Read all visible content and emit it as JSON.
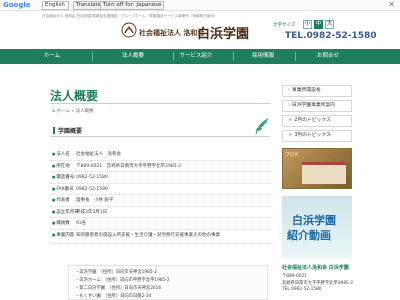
{
  "translate_bar": {
    "google_label": "Google",
    "translate_from_label": "Translate from:",
    "from_value": "English",
    "translate_button": "Translate",
    "turn_off_button": "Turn off for: Japanese",
    "close": "✕"
  },
  "header": {
    "tagline": "社会福祉法人 洛和会 白浜学園 障害者支援施設・グループホーム・障害福祉サービス事業所（宮崎県日南市）",
    "org_small": "社会福祉法人 洛和会",
    "org_big": "白浜学園",
    "fontsize_label": "文字サイズ",
    "fontsize_buttons": [
      "小",
      "中",
      "大"
    ],
    "tel": "TEL.0982-52-1580"
  },
  "nav": [
    "ホーム",
    "法人概要",
    "サービス紹介",
    "採用情報",
    "お問合せ"
  ],
  "main": {
    "page_title": "法人概要",
    "breadcrumb_home": "ホーム",
    "breadcrumb_current": "法人概要",
    "section_title": "学園概要",
    "rows": [
      {
        "label": "法人名",
        "value": "社会福祉法人　洛和会"
      },
      {
        "label": "所在地",
        "value": "〒889-0021　宮崎県日南市大字平野字北平2985-2"
      },
      {
        "label": "電話番号",
        "value": "0982-52-1580"
      },
      {
        "label": "FAX番号",
        "value": "0982-52-1599"
      },
      {
        "label": "代表者",
        "value": "理事長　小林 鋭子"
      },
      {
        "label": "設立年月日",
        "value": "平成3年3月1日"
      },
      {
        "label": "職員数",
        "value": "93名"
      },
      {
        "label": "事業内容",
        "value": "知的障害者の施設入所支援・生活介護・就労移行支援事業その他の事業"
      }
    ],
    "facilities": [
      "・白浜学園　（住所）日向市天神宮1985-2",
      "・白浜ホーム　（住所）日向市平野字北平1985-2",
      "・第二白浜学園　（住所）日向市天神宮2016",
      "・もくせい園　（住所）日向市日蔭2-34"
    ]
  },
  "sidebar": {
    "links": [
      "事業所開設長",
      "白浜学園事業所案内",
      "2月のトピックス",
      "3月のトピックス"
    ],
    "banner1_label": "ブログ",
    "banner2_line1": "白浜学園",
    "banner2_line2": "紹介動画",
    "name": "社会福祉法人洛和会 白浜学園",
    "postal": "〒889-0021",
    "address": "宮崎県日南市大字平野字北平2985-2",
    "tel": "TEL 0982-52-1580"
  }
}
